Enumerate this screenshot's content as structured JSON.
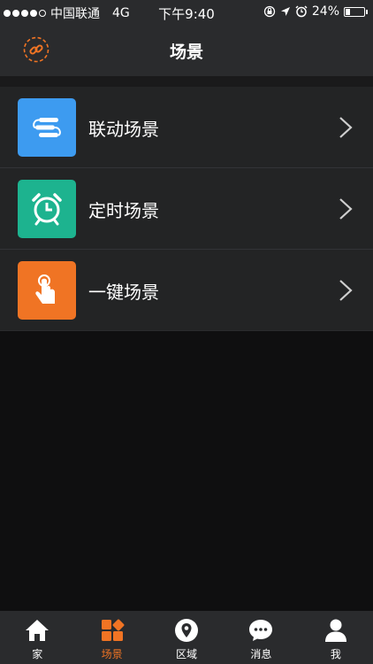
{
  "status_bar": {
    "carrier": "中国联通",
    "network": "4G",
    "time": "下午9:40",
    "battery": "24%",
    "battery_level": 0.24
  },
  "header": {
    "title": "场景",
    "logo_icon": "chain-link-icon"
  },
  "scenes": [
    {
      "label": "联动场景",
      "icon": "linkage-icon",
      "color": "#3d9bf0"
    },
    {
      "label": "定时场景",
      "icon": "alarm-clock-icon",
      "color": "#1db38f"
    },
    {
      "label": "一键场景",
      "icon": "tap-hand-icon",
      "color": "#f07424"
    }
  ],
  "tab_bar": {
    "items": [
      {
        "label": "家",
        "icon": "home-icon",
        "active": false
      },
      {
        "label": "场景",
        "icon": "scene-grid-icon",
        "active": true
      },
      {
        "label": "区域",
        "icon": "location-pin-icon",
        "active": false
      },
      {
        "label": "消息",
        "icon": "chat-bubble-icon",
        "active": false
      },
      {
        "label": "我",
        "icon": "person-icon",
        "active": false
      }
    ]
  },
  "colors": {
    "accent": "#f07424",
    "background": "#0f0f10",
    "bar": "#2a2b2d"
  }
}
